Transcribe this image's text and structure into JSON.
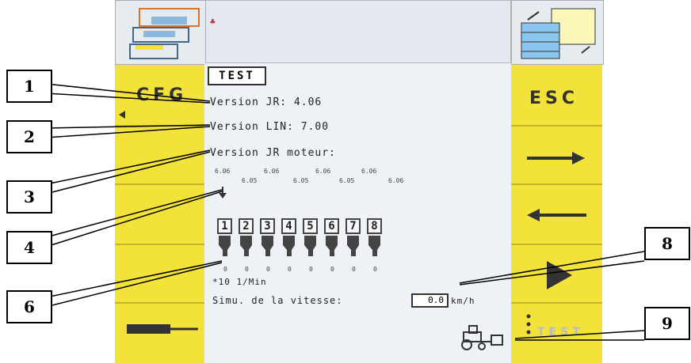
{
  "title_box": "TEST",
  "lines": {
    "version_jr": "Version JR:  4.06",
    "version_lin": "Version LIN:     7.00",
    "version_jr_moteur": "Version JR moteur:"
  },
  "motor_versions_top": [
    "6.06",
    "6.06",
    "6.06",
    "6.06"
  ],
  "motor_versions_bottom": [
    "6.05",
    "6.05",
    "6.05",
    "6.06"
  ],
  "row_numbers": [
    "1",
    "2",
    "3",
    "4",
    "5",
    "6",
    "7",
    "8"
  ],
  "row_values": [
    "0",
    "0",
    "0",
    "0",
    "0",
    "0",
    "0",
    "0"
  ],
  "unit_line": "*10 1/Min",
  "speed_label": "Simu. de la vitesse:",
  "speed_value": "0.0",
  "speed_unit": "km/h",
  "softkeys": {
    "left_top": "CFG",
    "right_top": "ESC",
    "right_bottom": "TEST"
  },
  "callouts": [
    "1",
    "2",
    "3",
    "4",
    "6",
    "8",
    "9"
  ],
  "colors": {
    "softkey": "#f3e23a",
    "panel": "#eef2f6"
  }
}
